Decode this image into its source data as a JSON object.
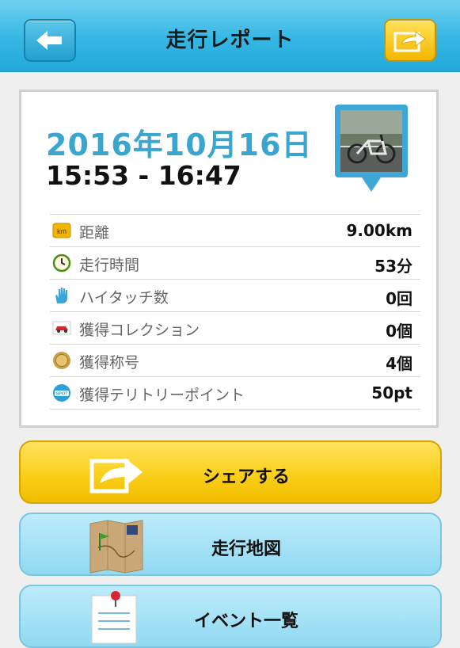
{
  "header": {
    "title": "走行レポート"
  },
  "report": {
    "date": "2016年10月16日",
    "time_range": "15:53 - 16:47"
  },
  "stats": [
    {
      "icon": "km-icon",
      "label": "距離",
      "value": "9.00km"
    },
    {
      "icon": "clock-icon",
      "label": "走行時間",
      "value": "53分"
    },
    {
      "icon": "hand-icon",
      "label": "ハイタッチ数",
      "value": "0回"
    },
    {
      "icon": "car-icon",
      "label": "獲得コレクション",
      "value": "0個"
    },
    {
      "icon": "medal-icon",
      "label": "獲得称号",
      "value": "4個"
    },
    {
      "icon": "spot-icon",
      "label": "獲得テリトリーポイント",
      "value": "50pt"
    }
  ],
  "actions": {
    "share_label": "シェアする",
    "map_label": "走行地図",
    "event_label": "イベント一覧"
  },
  "colors": {
    "header": "#35b7e4",
    "accent_date": "#3aa6cf",
    "share": "#f9cd16",
    "secondary": "#90d9f2"
  }
}
